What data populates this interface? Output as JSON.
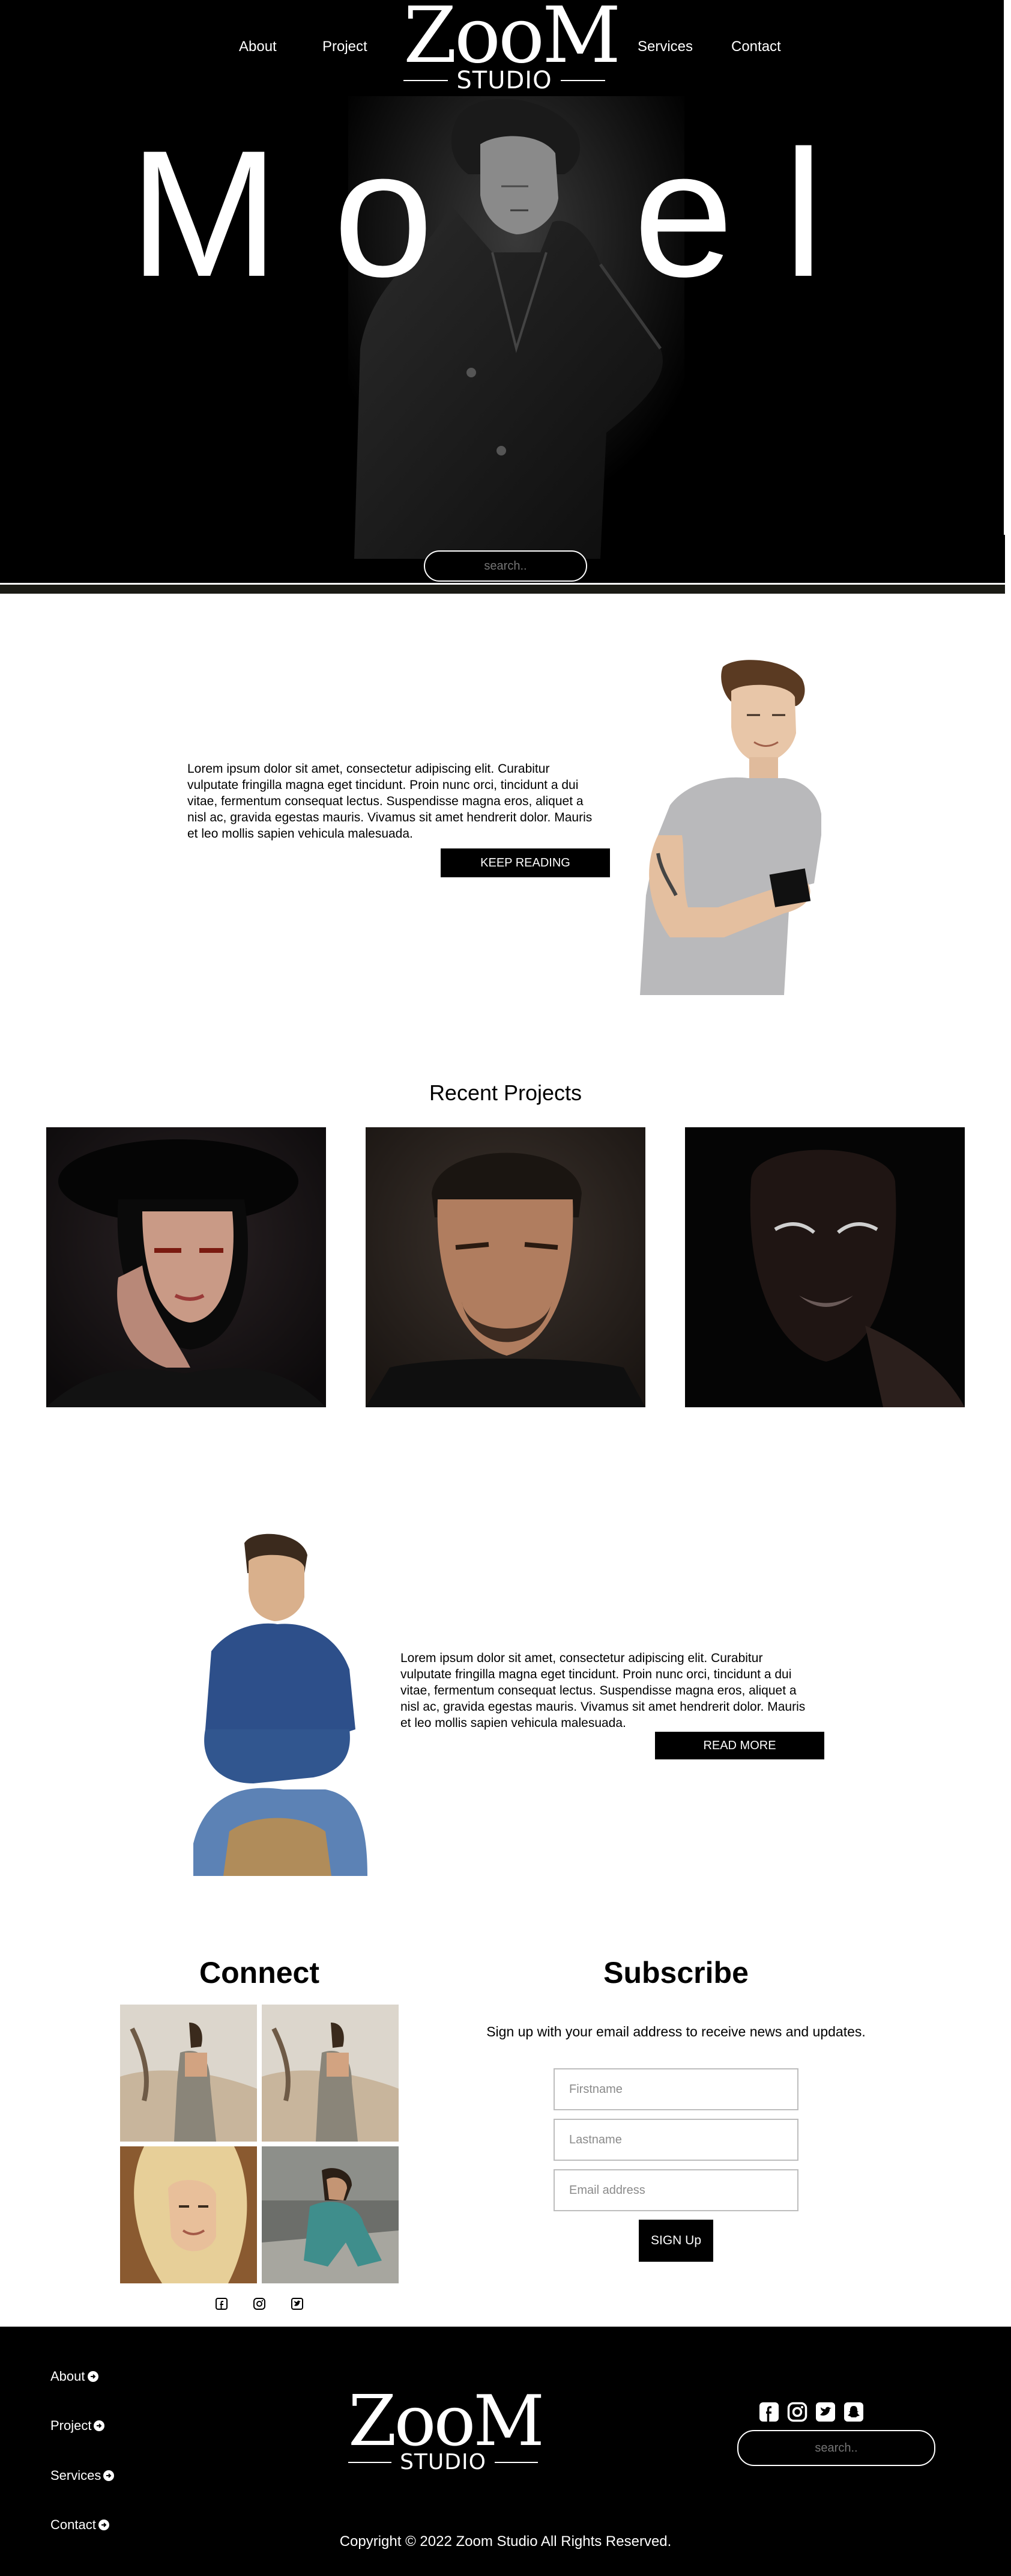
{
  "nav": {
    "about": "About",
    "project": "Project",
    "services": "Services",
    "contact": "Contact"
  },
  "logo": {
    "word": "ZooM",
    "sub": "STUDIO"
  },
  "hero": {
    "letters": [
      "M",
      "o",
      "e",
      "l"
    ],
    "search_placeholder": "search.."
  },
  "about": {
    "text": "Lorem ipsum dolor sit amet, consectetur adipiscing elit. Curabitur vulputate fringilla magna eget tincidunt. Proin nunc orci, tincidunt a dui vitae, fermentum consequat lectus. Suspendisse magna eros, aliquet a nisl ac, gravida egestas mauris. Vivamus sit amet hendrerit dolor. Mauris et leo mollis sapien vehicula malesuada.",
    "button": "KEEP READING"
  },
  "recent": {
    "title": "Recent Projects"
  },
  "feature": {
    "text": "Lorem ipsum dolor sit amet, consectetur adipiscing elit. Curabitur vulputate fringilla magna eget tincidunt. Proin nunc orci, tincidunt a dui vitae, fermentum consequat lectus. Suspendisse magna eros, aliquet a nisl ac, gravida egestas mauris. Vivamus sit amet hendrerit dolor. Mauris et leo mollis sapien vehicula malesuada.",
    "button": "READ MORE"
  },
  "connect": {
    "title": "Connect",
    "icons": [
      "facebook-icon",
      "instagram-icon",
      "twitter-icon"
    ]
  },
  "subscribe": {
    "title": "Subscribe",
    "description": "Sign up with your email address to receive news and updates.",
    "firstname_placeholder": "Firstname",
    "lastname_placeholder": "Lastname",
    "email_placeholder": "Email address",
    "button": "SIGN Up"
  },
  "footer": {
    "links": [
      "About",
      "Project",
      "Services",
      "Contact"
    ],
    "social_icons": [
      "facebook-icon",
      "instagram-icon",
      "twitter-icon",
      "snapchat-icon"
    ],
    "search_placeholder": "search..",
    "copyright": "Copyright © 2022 Zoom Studio All Rights Reserved."
  },
  "colors": {
    "background": "#000000",
    "accent": "#ffffff",
    "page": "#ffffff"
  }
}
